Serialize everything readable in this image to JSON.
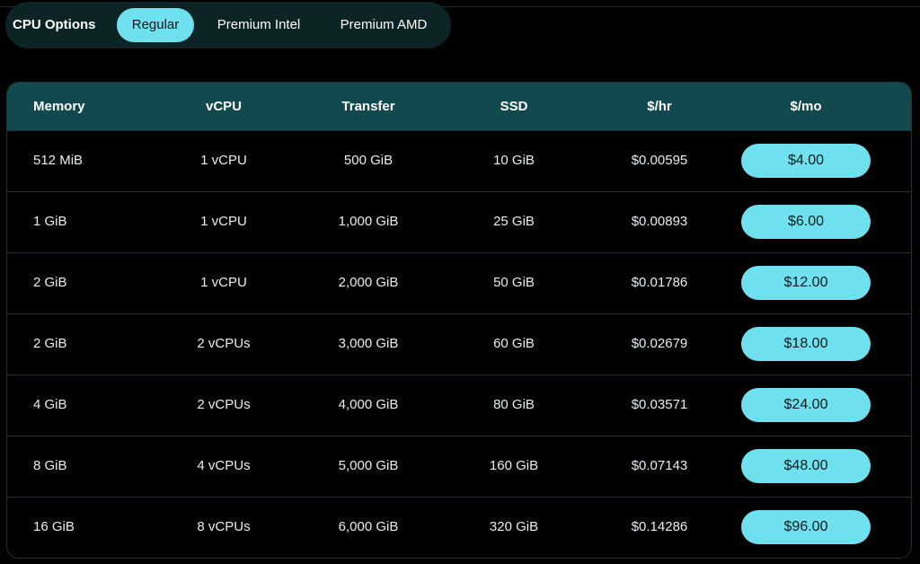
{
  "cpu_options": {
    "label": "CPU Options",
    "tabs": [
      {
        "label": "Regular",
        "active": true
      },
      {
        "label": "Premium Intel",
        "active": false
      },
      {
        "label": "Premium AMD",
        "active": false
      }
    ]
  },
  "table": {
    "headers": {
      "memory": "Memory",
      "vcpu": "vCPU",
      "transfer": "Transfer",
      "ssd": "SSD",
      "hourly": "$/hr",
      "monthly": "$/mo"
    },
    "rows": [
      {
        "memory": "512 MiB",
        "vcpu": "1 vCPU",
        "transfer": "500 GiB",
        "ssd": "10 GiB",
        "hourly": "$0.00595",
        "monthly": "$4.00"
      },
      {
        "memory": "1 GiB",
        "vcpu": "1 vCPU",
        "transfer": "1,000 GiB",
        "ssd": "25 GiB",
        "hourly": "$0.00893",
        "monthly": "$6.00"
      },
      {
        "memory": "2 GiB",
        "vcpu": "1 vCPU",
        "transfer": "2,000 GiB",
        "ssd": "50 GiB",
        "hourly": "$0.01786",
        "monthly": "$12.00"
      },
      {
        "memory": "2 GiB",
        "vcpu": "2 vCPUs",
        "transfer": "3,000 GiB",
        "ssd": "60 GiB",
        "hourly": "$0.02679",
        "monthly": "$18.00"
      },
      {
        "memory": "4 GiB",
        "vcpu": "2 vCPUs",
        "transfer": "4,000 GiB",
        "ssd": "80 GiB",
        "hourly": "$0.03571",
        "monthly": "$24.00"
      },
      {
        "memory": "8 GiB",
        "vcpu": "4 vCPUs",
        "transfer": "5,000 GiB",
        "ssd": "160 GiB",
        "hourly": "$0.07143",
        "monthly": "$48.00"
      },
      {
        "memory": "16 GiB",
        "vcpu": "8 vCPUs",
        "transfer": "6,000 GiB",
        "ssd": "320 GiB",
        "hourly": "$0.14286",
        "monthly": "$96.00"
      }
    ]
  },
  "colors": {
    "accent": "#6ee0ee",
    "header_bg": "#12494f",
    "tab_bar_bg": "#0c2426",
    "background": "#000000"
  }
}
